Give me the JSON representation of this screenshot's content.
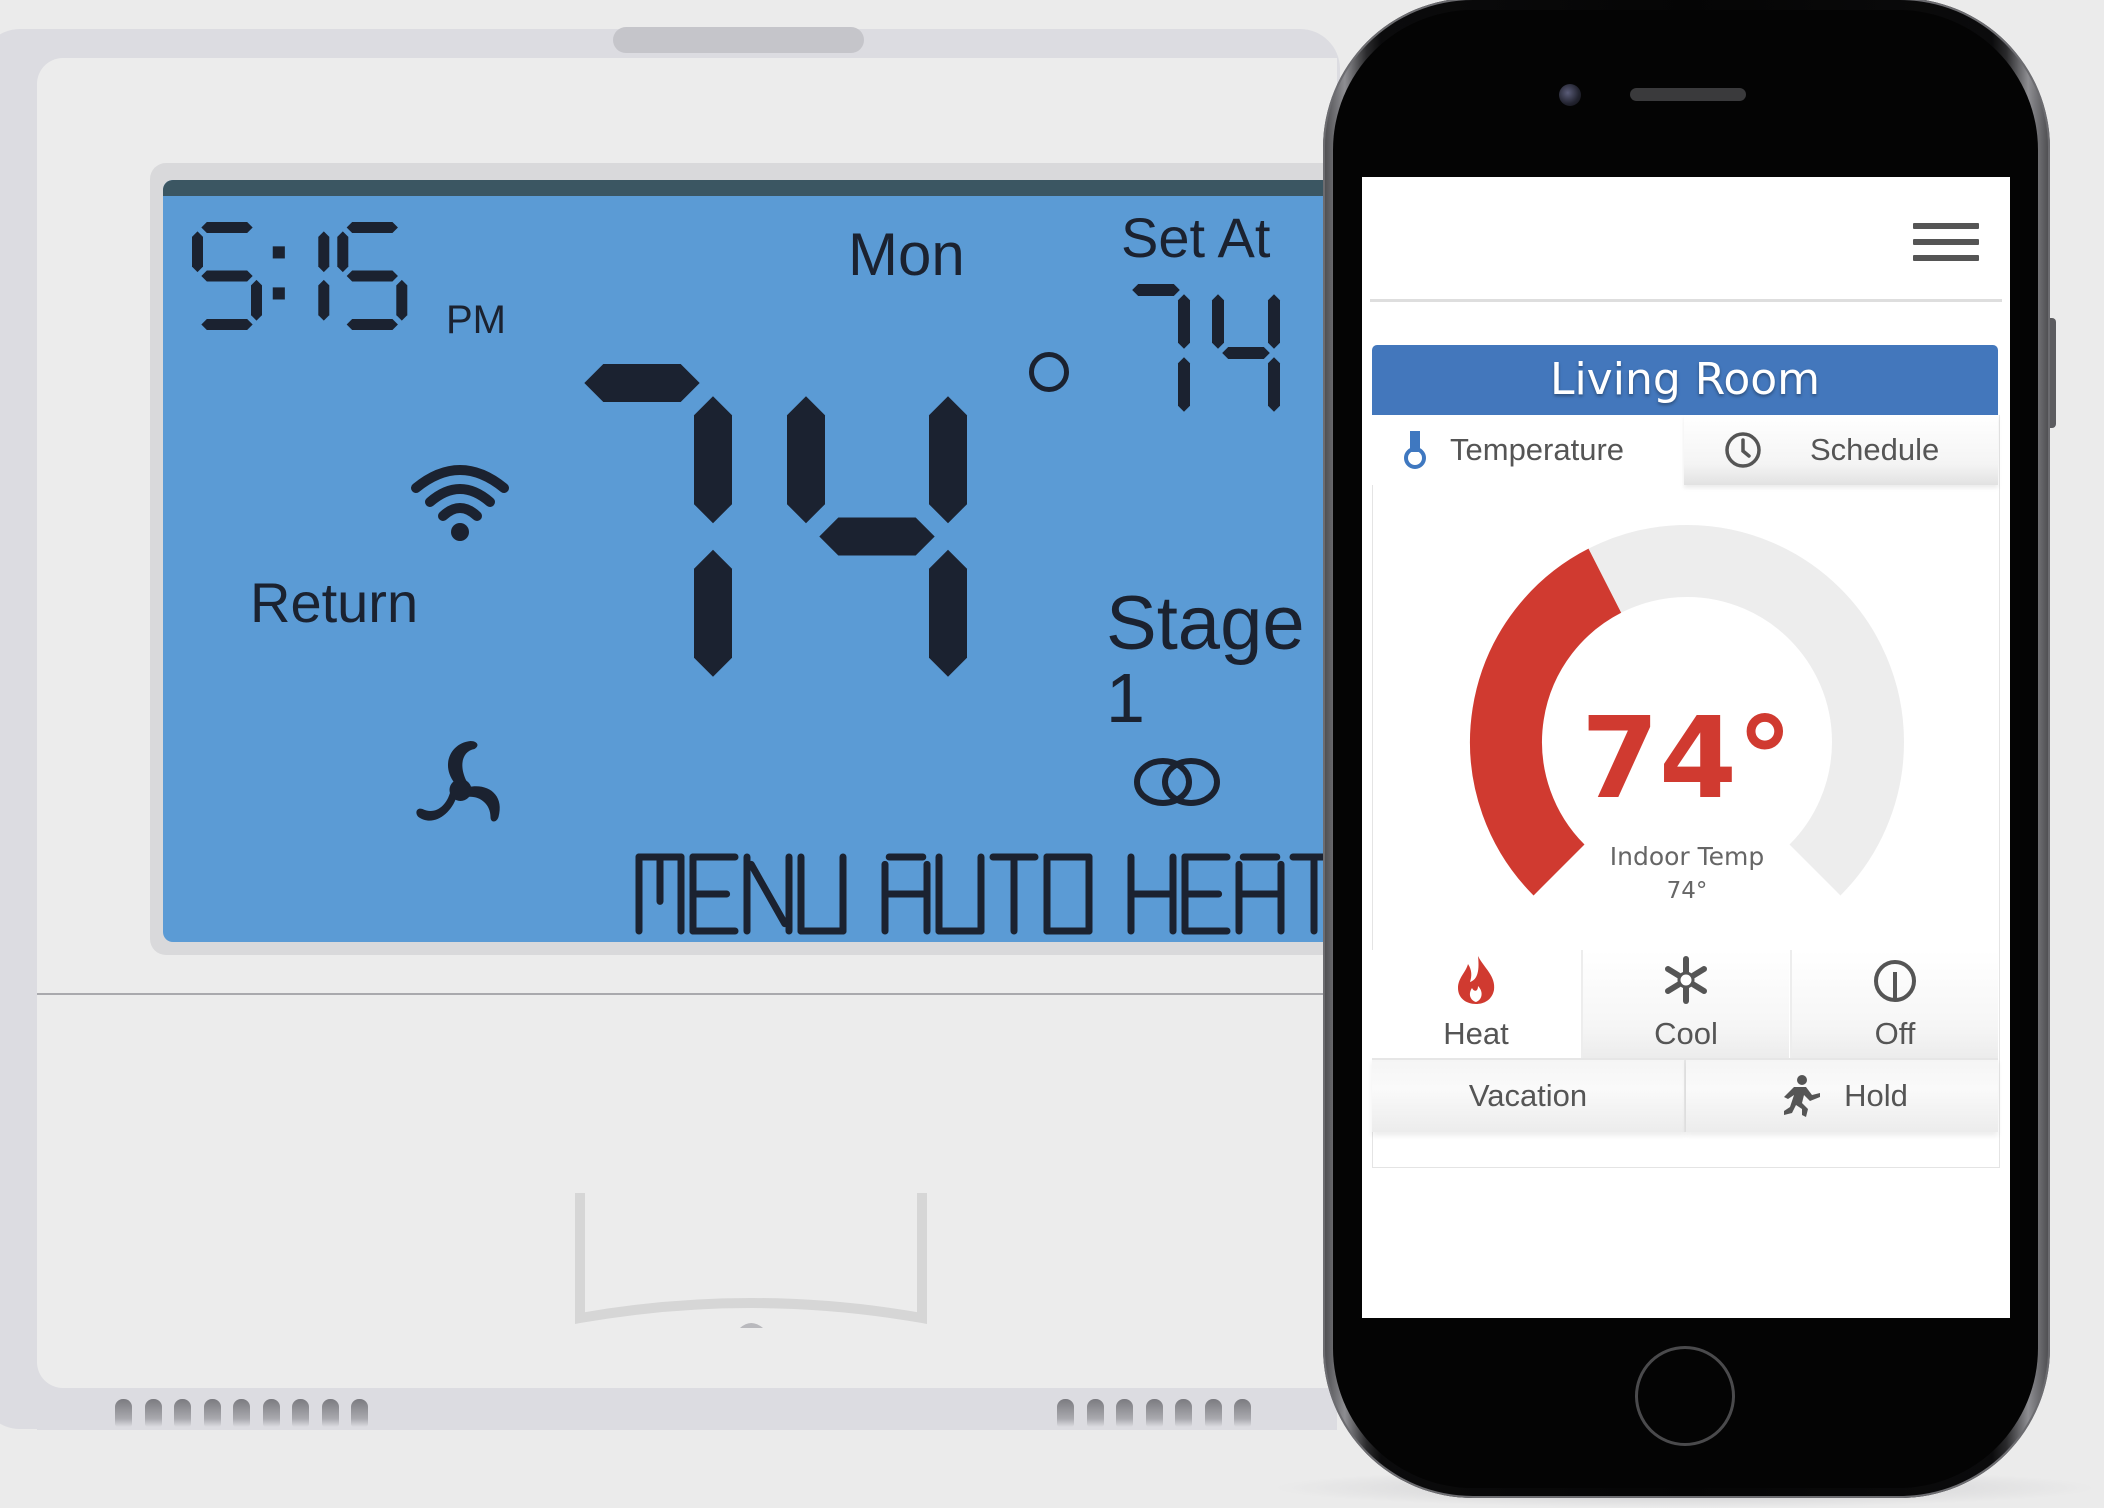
{
  "thermostat": {
    "time": {
      "digits": "5:15",
      "meridiem": "PM"
    },
    "day": "Mon",
    "set_at_label": "Set At",
    "setpoint": "74",
    "current_temp": "74",
    "degree_symbol": "°",
    "return_label": "Return",
    "stage_label": "Stage",
    "stage_value": "1",
    "bottom_menu": "MENU AUTO HEAT",
    "icons": {
      "wifi": "wifi-icon",
      "fan": "fan-icon",
      "stage": "linked-circles-icon"
    },
    "colors": {
      "lcd_blue": "#5b9bd5",
      "lcd_segment": "#1b2230",
      "lcd_topbar": "#3b5662",
      "body": "#ececec"
    }
  },
  "phone_app": {
    "menu_icon": "hamburger-menu-icon",
    "room_title": "Living Room",
    "tabs": [
      {
        "label": "Temperature",
        "icon": "thermometer-icon",
        "active": true
      },
      {
        "label": "Schedule",
        "icon": "clock-icon",
        "active": false
      }
    ],
    "gauge": {
      "value_text": "74°",
      "subtitle": "Indoor Temp",
      "subtitle_value": "74°",
      "fill_fraction": 0.4,
      "fill_color": "#d03a30",
      "track_color": "#ededed"
    },
    "modes": [
      {
        "label": "Heat",
        "icon": "flame-icon",
        "active": true,
        "color": "#d03a30"
      },
      {
        "label": "Cool",
        "icon": "snowflake-icon",
        "active": false
      },
      {
        "label": "Off",
        "icon": "power-icon",
        "active": false
      }
    ],
    "actions": [
      {
        "label": "Vacation",
        "icon": null
      },
      {
        "label": "Hold",
        "icon": "running-person-icon"
      }
    ],
    "colors": {
      "header_blue": "#4377bc",
      "text": "#555555"
    }
  }
}
